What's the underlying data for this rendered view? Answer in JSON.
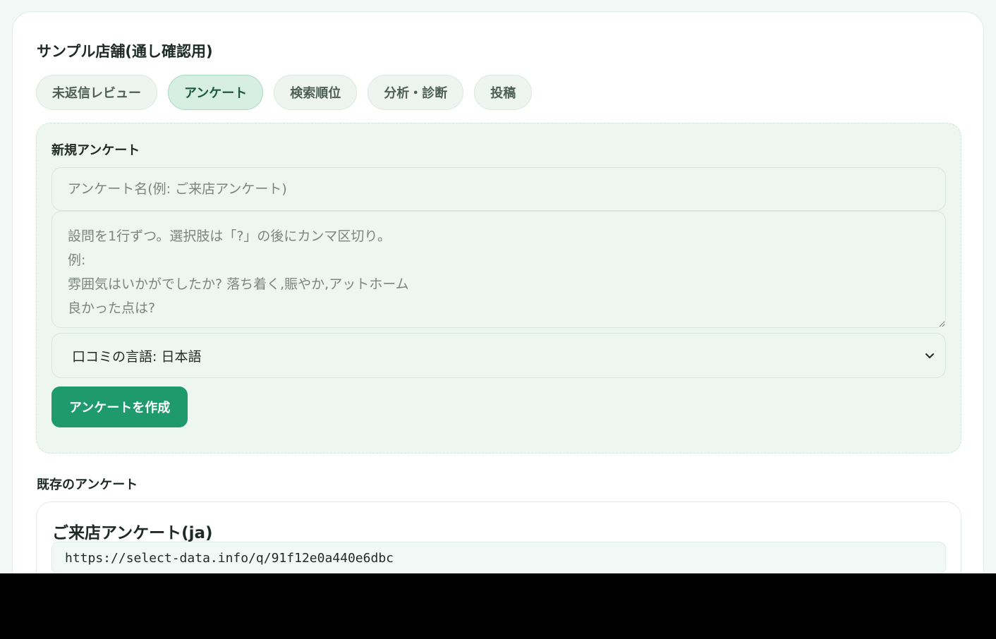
{
  "store": {
    "title": "サンプル店舗(通し確認用)"
  },
  "tabs": [
    {
      "label": "未返信レビュー",
      "active": false
    },
    {
      "label": "アンケート",
      "active": true
    },
    {
      "label": "検索順位",
      "active": false
    },
    {
      "label": "分析・診断",
      "active": false
    },
    {
      "label": "投稿",
      "active": false
    }
  ],
  "new_survey": {
    "title": "新規アンケート",
    "name_placeholder": "アンケート名(例: ご来店アンケート)",
    "name_value": "",
    "questions_placeholder": "設問を1行ずつ。選択肢は「?」の後にカンマ区切り。\n例:\n雰囲気はいかがでしたか? 落ち着く,賑やか,アットホーム\n良かった点は?",
    "questions_value": "",
    "language_select": {
      "selected": "口コミの言語: 日本語",
      "icon": "chevron-down-icon"
    },
    "create_button": "アンケートを作成"
  },
  "existing": {
    "title": "既存のアンケート",
    "surveys": [
      {
        "name": "ご来店アンケート(ja)",
        "url": "https://select-data.info/q/91f12e0a440e6dbc"
      }
    ]
  },
  "colors": {
    "page_background": "#f2f8f5",
    "card_background": "#ffffff",
    "panel_background": "#edf6f1",
    "active_tab_background": "#d7efe3",
    "primary_button": "#1e9a6e"
  }
}
